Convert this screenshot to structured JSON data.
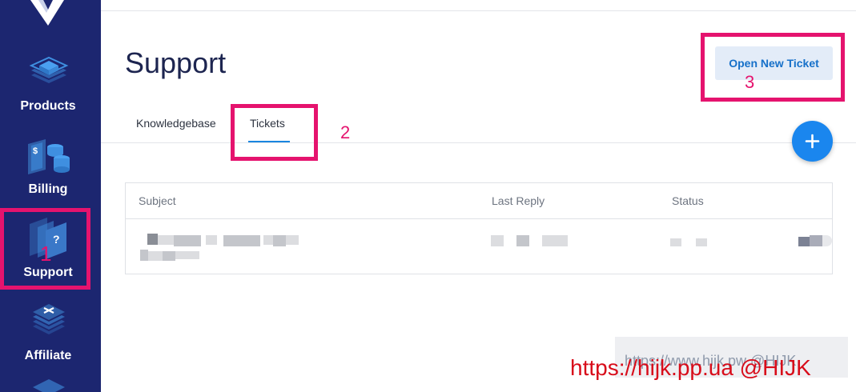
{
  "sidebar": {
    "items": [
      {
        "label": "Products",
        "icon": "layers-icon"
      },
      {
        "label": "Billing",
        "icon": "billing-icon"
      },
      {
        "label": "Support",
        "icon": "support-icon"
      },
      {
        "label": "Affiliate",
        "icon": "affiliate-icon"
      }
    ],
    "colors": {
      "background": "#1c2670",
      "icon": "#3f8fe0"
    }
  },
  "page": {
    "title": "Support",
    "open_ticket_label": "Open New Ticket"
  },
  "tabs": [
    {
      "label": "Knowledgebase",
      "active": false
    },
    {
      "label": "Tickets",
      "active": true
    }
  ],
  "table": {
    "columns": [
      "Subject",
      "Last Reply",
      "Status"
    ]
  },
  "annotations": {
    "step1": "1",
    "step2": "2",
    "step3": "3",
    "highlight_color": "#e5136e"
  },
  "watermark": {
    "faint": "https://www.hijk.pw @HIJK",
    "main": "https://hijk.pp.ua @HIJK"
  }
}
